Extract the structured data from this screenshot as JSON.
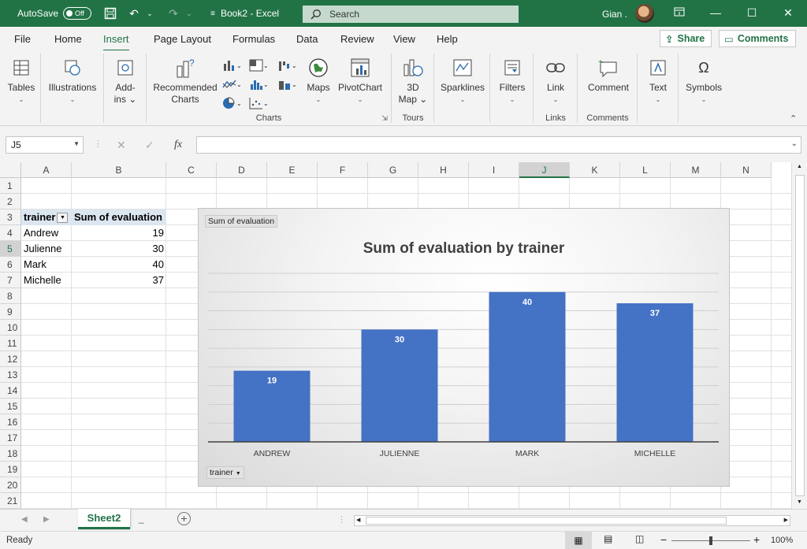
{
  "titlebar": {
    "autosave_label": "AutoSave",
    "autosave_state": "Off",
    "doc_title": "Book2  -  Excel",
    "search_placeholder": "Search",
    "user_name": "Gian ."
  },
  "ribbon_tabs": [
    "File",
    "Home",
    "Insert",
    "Page Layout",
    "Formulas",
    "Data",
    "Review",
    "View",
    "Help"
  ],
  "active_tab": "Insert",
  "share_label": "Share",
  "comments_label": "Comments",
  "ribbon": {
    "tables": "Tables",
    "illustrations": "Illustrations",
    "addins_1": "Add-",
    "addins_2": "ins",
    "recommended_1": "Recommended",
    "recommended_2": "Charts",
    "maps": "Maps",
    "pivotchart": "PivotChart",
    "map3d_1": "3D",
    "map3d_2": "Map",
    "sparklines": "Sparklines",
    "filters": "Filters",
    "link": "Link",
    "comment": "Comment",
    "text": "Text",
    "symbols": "Symbols",
    "group_charts": "Charts",
    "group_tours": "Tours",
    "group_links": "Links",
    "group_comments": "Comments"
  },
  "formula_bar": {
    "name_box": "J5",
    "cancel": "✕",
    "enter": "✓",
    "fx": "fx",
    "value": ""
  },
  "columns": [
    "A",
    "B",
    "C",
    "D",
    "E",
    "F",
    "G",
    "H",
    "I",
    "J",
    "K",
    "L",
    "M",
    "N"
  ],
  "selected_column": "J",
  "selected_row": 5,
  "rows": [
    1,
    2,
    3,
    4,
    5,
    6,
    7,
    8,
    9,
    10,
    11,
    12,
    13,
    14,
    15,
    16,
    17,
    18,
    19,
    20,
    21
  ],
  "pivot": {
    "header_field": "trainer",
    "header_value": "Sum of evaluation",
    "rows": [
      {
        "label": "Andrew",
        "value": "19"
      },
      {
        "label": "Julienne",
        "value": "30"
      },
      {
        "label": "Mark",
        "value": "40"
      },
      {
        "label": "Michelle",
        "value": "37"
      }
    ]
  },
  "chart_field_value_button": "Sum of evaluation",
  "chart_field_axis_button": "trainer",
  "chart_data": {
    "type": "bar",
    "title": "Sum of evaluation by trainer",
    "categories": [
      "ANDREW",
      "JULIENNE",
      "MARK",
      "MICHELLE"
    ],
    "values": [
      19,
      30,
      40,
      37
    ],
    "ylim": [
      0,
      45
    ],
    "grid": true,
    "data_labels": true,
    "bar_color": "#4472c4",
    "legend": "none"
  },
  "sheets": [
    "Sheet2"
  ],
  "status": {
    "ready": "Ready",
    "zoom": "100%"
  },
  "colors": {
    "accent": "#217346",
    "bar": "#4472c4"
  }
}
